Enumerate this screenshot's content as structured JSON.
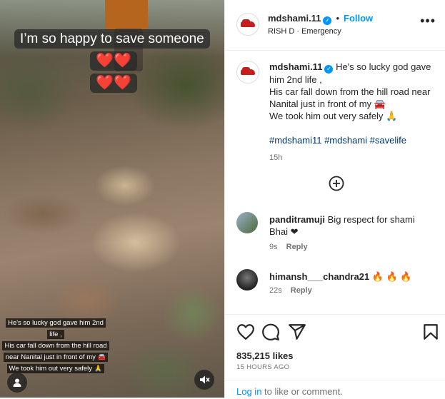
{
  "media": {
    "overlay_line1": "I’m so happy to save someone",
    "overlay_hearts1": "❤️❤️",
    "overlay_hearts2": "❤️❤️",
    "caption_lines": [
      "He's so lucky god gave him 2nd life ,",
      "His car fall down from the hill road",
      "near Nanital just in front of my 🚘",
      "We took him out very safely 🙏"
    ],
    "user_icon": "user-icon",
    "mute_icon": "speaker-muted-icon"
  },
  "header": {
    "username": "mdshami.11",
    "separator": "•",
    "follow_label": "Follow",
    "audio_artist": "RISH D",
    "audio_separator": "·",
    "audio_title": "Emergency",
    "more_icon": "more-options-icon"
  },
  "post": {
    "username": "mdshami.11",
    "caption_line1": "He's so lucky god gave him 2nd life ,",
    "caption_line2": "His car fall down from the hill road near Nanital just in front of my 🚘",
    "caption_line3": "We took him out very safely 🙏",
    "hashtags": "#mdshami11 #mdshami #savelife",
    "time": "15h"
  },
  "comments": [
    {
      "username": "panditramuji",
      "text": "Big respect for shami Bhai ❤",
      "time": "9s",
      "reply_label": "Reply"
    },
    {
      "username": "himansh___chandra21",
      "text": "🔥 🔥 🔥",
      "time": "22s",
      "reply_label": "Reply"
    }
  ],
  "actions": {
    "likes": "835,215 likes",
    "time_ago": "15 HOURS AGO",
    "login_link": "Log in",
    "login_rest": "to like or comment."
  },
  "colors": {
    "accent": "#0095f6",
    "hashtag": "#00376b",
    "muted": "#737373",
    "heart": "#e01b1b",
    "fire": "#f08c1a"
  }
}
